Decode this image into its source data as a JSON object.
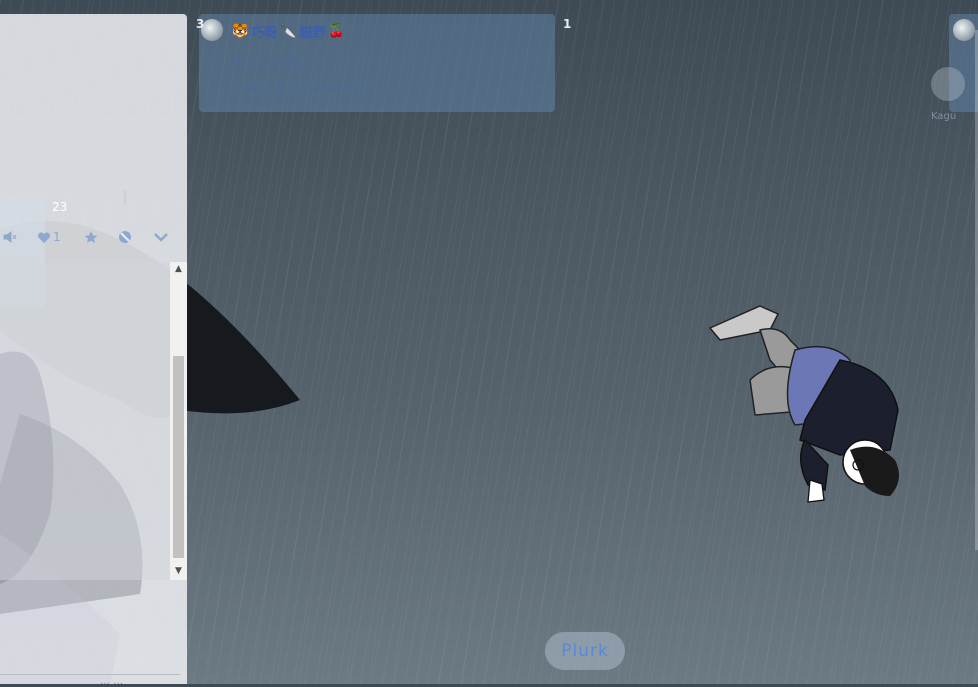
{
  "left_panel": {
    "response_count": "23",
    "like_count": "1",
    "footer_text": "… …"
  },
  "plurk": {
    "responses_badge": "3",
    "replurk_badge": "1",
    "author_emoji_1": "🐯",
    "author_name_1": "巧呀",
    "author_emoji_2": "🔪",
    "author_name_2": "貓野",
    "author_emoji_3": "🍒",
    "line_1": "很久沒放圖",
    "line_2": "以為自己可以練到光影"
  },
  "right_partial": {
    "label": "Kagu"
  },
  "composer": {
    "plurk_button": "Plurk"
  },
  "icons": [
    "mute-icon",
    "heart-icon",
    "star-icon",
    "block-icon",
    "chevron-down-icon",
    "scroll-up-icon",
    "scroll-down-icon"
  ],
  "colors": {
    "accent": "#5a8ad6",
    "name": "#3b5fb0",
    "card": "#6082a6"
  }
}
